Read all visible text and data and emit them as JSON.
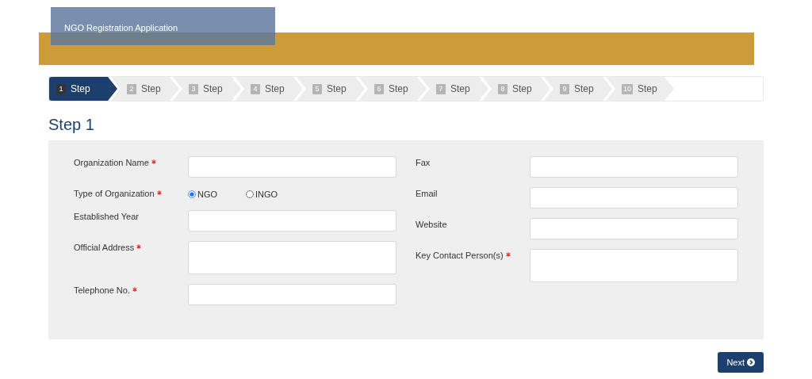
{
  "header": {
    "title": "NGO Registration Application"
  },
  "steps": [
    {
      "number": "1",
      "label": "Step",
      "selected": true
    },
    {
      "number": "2",
      "label": "Step",
      "selected": false
    },
    {
      "number": "3",
      "label": "Step",
      "selected": false
    },
    {
      "number": "4",
      "label": "Step",
      "selected": false
    },
    {
      "number": "5",
      "label": "Step",
      "selected": false
    },
    {
      "number": "6",
      "label": "Step",
      "selected": false
    },
    {
      "number": "7",
      "label": "Step",
      "selected": false
    },
    {
      "number": "8",
      "label": "Step",
      "selected": false
    },
    {
      "number": "9",
      "label": "Step",
      "selected": false
    },
    {
      "number": "10",
      "label": "Step",
      "selected": false
    }
  ],
  "heading": "Step 1",
  "form": {
    "left": [
      {
        "kind": "text",
        "label": "Organization Name",
        "required": true
      },
      {
        "kind": "radio",
        "label": "Type of Organization",
        "required": true,
        "options": [
          {
            "label": "NGO",
            "selected": true
          },
          {
            "label": "INGO",
            "selected": false
          }
        ]
      },
      {
        "kind": "text",
        "label": "Established Year",
        "required": false
      },
      {
        "kind": "textarea",
        "label": "Official Address",
        "required": true
      },
      {
        "kind": "text",
        "label": "Telephone No.",
        "required": true
      }
    ],
    "right": [
      {
        "kind": "text",
        "label": "Fax",
        "required": false
      },
      {
        "kind": "text",
        "label": "Email",
        "required": false
      },
      {
        "kind": "text",
        "label": "Website",
        "required": false
      },
      {
        "kind": "textarea",
        "label": "Key Contact Person(s)",
        "required": true
      }
    ]
  },
  "next_button": {
    "label": "Next"
  }
}
